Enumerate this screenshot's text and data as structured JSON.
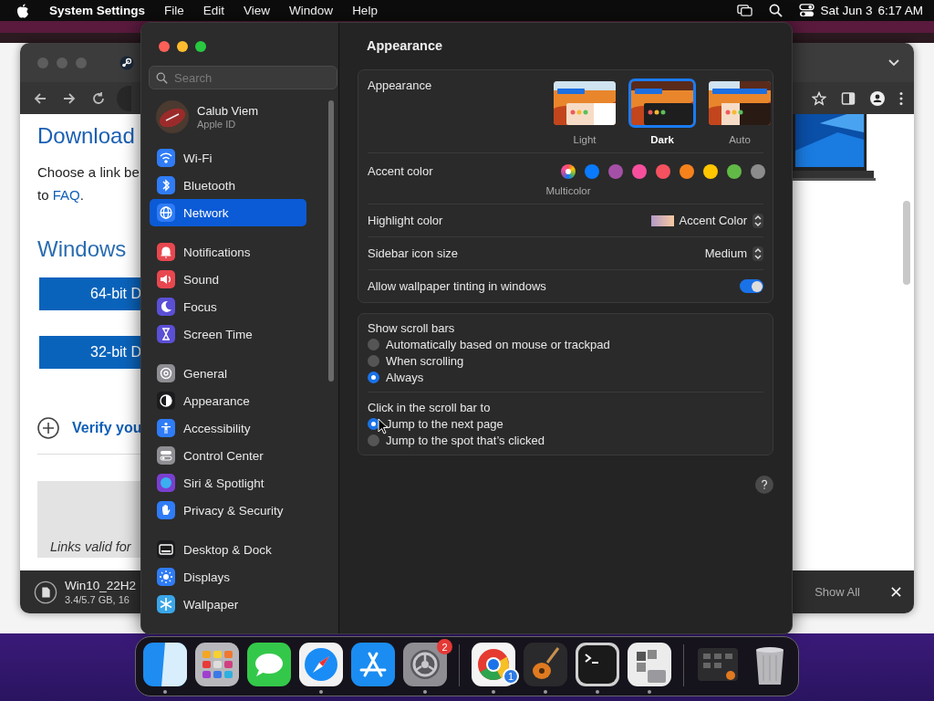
{
  "menu_bar": {
    "app_name": "System Settings",
    "menus": [
      "File",
      "Edit",
      "View",
      "Window",
      "Help"
    ],
    "date": "Sat Jun 3",
    "time": "6:17 AM"
  },
  "browser": {
    "heading": "Download",
    "intro": "Choose a link be",
    "intro_prefix": "to ",
    "faq_link": "FAQ",
    "intro_suffix": ".",
    "section_heading": "Windows",
    "buttons": [
      "64-bit D",
      "32-bit D"
    ],
    "verify_link": "Verify you",
    "note": "Links valid for",
    "download": {
      "file": "Win10_22H2",
      "progress": "3.4/5.7 GB, 16"
    },
    "show_all": "Show All"
  },
  "settings": {
    "search": {
      "placeholder": "Search"
    },
    "account": {
      "name": "Calub Viem",
      "subtitle": "Apple ID"
    },
    "sidebar_groups": [
      [
        {
          "label": "Wi-Fi",
          "kind": "wifi",
          "color": "#2f7cf6",
          "selected": false
        },
        {
          "label": "Bluetooth",
          "kind": "bluetooth",
          "color": "#2f7cf6",
          "selected": false
        },
        {
          "label": "Network",
          "kind": "globe",
          "color": "#2f7cf6",
          "selected": true
        }
      ],
      [
        {
          "label": "Notifications",
          "kind": "bell",
          "color": "#e8474f",
          "selected": false
        },
        {
          "label": "Sound",
          "kind": "speaker",
          "color": "#e8474f",
          "selected": false
        },
        {
          "label": "Focus",
          "kind": "moon",
          "color": "#5b4fd6",
          "selected": false
        },
        {
          "label": "Screen Time",
          "kind": "hourglass",
          "color": "#5b4fd6",
          "selected": false
        }
      ],
      [
        {
          "label": "General",
          "kind": "gear",
          "color": "#8e8e93",
          "selected": false
        },
        {
          "label": "Appearance",
          "kind": "contrast",
          "color": "#1c1c1e",
          "selected": false
        },
        {
          "label": "Accessibility",
          "kind": "person",
          "color": "#2f7cf6",
          "selected": false
        },
        {
          "label": "Control Center",
          "kind": "toggles",
          "color": "#8e8e93",
          "selected": false
        },
        {
          "label": "Siri & Spotlight",
          "kind": "orb",
          "color": "#7a3fd0",
          "selected": false
        },
        {
          "label": "Privacy & Security",
          "kind": "hand",
          "color": "#2f7cf6",
          "selected": false
        }
      ],
      [
        {
          "label": "Desktop & Dock",
          "kind": "dock",
          "color": "#1c1c1e",
          "selected": false
        },
        {
          "label": "Displays",
          "kind": "sun",
          "color": "#2f7cf6",
          "selected": false
        },
        {
          "label": "Wallpaper",
          "kind": "snowflake",
          "color": "#3aa6e8",
          "selected": false
        }
      ]
    ],
    "page_title": "Appearance",
    "appearance": {
      "label": "Appearance",
      "options": [
        {
          "label": "Light",
          "kind": "light",
          "selected": false
        },
        {
          "label": "Dark",
          "kind": "dark",
          "selected": true
        },
        {
          "label": "Auto",
          "kind": "auto",
          "selected": false
        }
      ]
    },
    "accent": {
      "label": "Accent color",
      "colors": [
        {
          "kind": "multicolor",
          "caption": "Multicolor",
          "selected": true
        },
        {
          "kind": "solid",
          "color": "#0a7aff",
          "selected": false
        },
        {
          "kind": "solid",
          "color": "#a550a7",
          "selected": false
        },
        {
          "kind": "solid",
          "color": "#f74f9e",
          "selected": false
        },
        {
          "kind": "solid",
          "color": "#f5515f",
          "selected": false
        },
        {
          "kind": "solid",
          "color": "#f7821b",
          "selected": false
        },
        {
          "kind": "solid",
          "color": "#ffc600",
          "selected": false
        },
        {
          "kind": "solid",
          "color": "#62ba46",
          "selected": false
        },
        {
          "kind": "solid",
          "color": "#8c8c8c",
          "selected": false
        }
      ]
    },
    "highlight": {
      "label": "Highlight color",
      "value": "Accent Color"
    },
    "icon_size": {
      "label": "Sidebar icon size",
      "value": "Medium"
    },
    "tinting": {
      "label": "Allow wallpaper tinting in windows",
      "on": true
    },
    "scroll_groups": [
      {
        "label": "Show scroll bars",
        "options": [
          {
            "label": "Automatically based on mouse or trackpad",
            "selected": false
          },
          {
            "label": "When scrolling",
            "selected": false
          },
          {
            "label": "Always",
            "selected": true
          }
        ]
      },
      {
        "label": "Click in the scroll bar to",
        "options": [
          {
            "label": "Jump to the next page",
            "selected": true
          },
          {
            "label": "Jump to the spot that’s clicked",
            "selected": false
          }
        ]
      }
    ]
  },
  "dock": {
    "apps": [
      {
        "kind": "finder",
        "running": true
      },
      {
        "kind": "launchpad",
        "running": false
      },
      {
        "kind": "messages",
        "running": false
      },
      {
        "kind": "safari",
        "running": true
      },
      {
        "kind": "appstore",
        "running": false
      },
      {
        "kind": "settings",
        "running": true,
        "badge": "2"
      },
      {
        "kind": "separator"
      },
      {
        "kind": "chrome",
        "running": true,
        "badge": "1"
      },
      {
        "kind": "guitar",
        "running": true
      },
      {
        "kind": "terminal",
        "running": true
      },
      {
        "kind": "bootcamp",
        "running": true
      },
      {
        "kind": "separator"
      },
      {
        "kind": "stack",
        "running": false
      },
      {
        "kind": "trash",
        "running": false
      }
    ]
  }
}
